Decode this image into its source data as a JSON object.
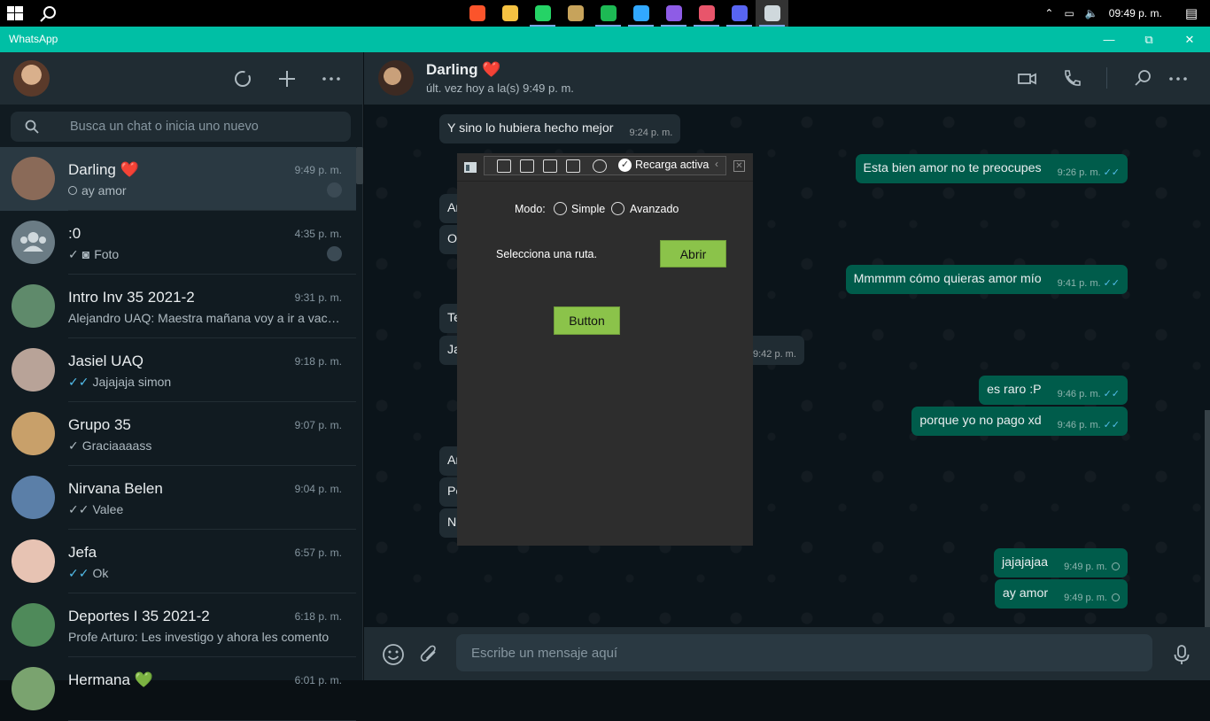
{
  "taskbar": {
    "time": "09:49 p. m.",
    "apps": [
      {
        "name": "brave-icon",
        "color": "#fb542b"
      },
      {
        "name": "file-explorer-icon",
        "color": "#f5c242"
      },
      {
        "name": "whatsapp-icon",
        "color": "#25d366"
      },
      {
        "name": "league-icon",
        "color": "#c7a35b"
      },
      {
        "name": "spotify-icon",
        "color": "#1db954"
      },
      {
        "name": "photoshop-icon",
        "color": "#31a8ff"
      },
      {
        "name": "visual-studio-icon",
        "color": "#8e5ce6"
      },
      {
        "name": "layers-icon",
        "color": "#e8556b"
      },
      {
        "name": "discord-icon",
        "color": "#5865f2"
      },
      {
        "name": "app-window-icon",
        "color": "#cfd8dc"
      }
    ]
  },
  "window": {
    "title": "WhatsApp"
  },
  "sidebar": {
    "search_placeholder": "Busca un chat o inicia uno nuevo",
    "chats": [
      {
        "name": "Darling ❤️",
        "time": "9:49 p. m.",
        "preview": "ay amor",
        "status": "clock",
        "pinned": true,
        "avatar": "#8a6a58"
      },
      {
        "name": ":0",
        "time": "4:35 p. m.",
        "preview": "Foto",
        "status": "single-tick",
        "photo": true,
        "pinned": true,
        "avatar": "#6b7c85"
      },
      {
        "name": "Intro Inv 35 2021-2",
        "time": "9:31 p. m.",
        "preview": "Alejandro UAQ: Maestra mañana voy a ir a vacu...",
        "status": "none",
        "avatar": "#5f8a6b"
      },
      {
        "name": "Jasiel UAQ",
        "time": "9:18 p. m.",
        "preview": "Jajajaja simon",
        "status": "blue-ticks",
        "avatar": "#b8a398"
      },
      {
        "name": "Grupo 35",
        "time": "9:07 p. m.",
        "preview": "Graciaaaass",
        "status": "single-tick",
        "avatar": "#c8a06a"
      },
      {
        "name": "Nirvana Belen",
        "time": "9:04 p. m.",
        "preview": "Valee",
        "status": "grey-ticks",
        "avatar": "#5b7fa8"
      },
      {
        "name": "Jefa",
        "time": "6:57 p. m.",
        "preview": "Ok",
        "status": "blue-ticks",
        "avatar": "#e7c3b3"
      },
      {
        "name": "Deportes I 35 2021-2",
        "time": "6:18 p. m.",
        "preview": "Profe Arturo: Les investigo y ahora les comento",
        "status": "none",
        "avatar": "#4f8a5a"
      },
      {
        "name": "Hermana 💚",
        "time": "6:01 p. m.",
        "preview": "",
        "status": "none",
        "avatar": "#7aa36f"
      }
    ]
  },
  "chat": {
    "contact_name": "Darling ❤️",
    "contact_status": "últ. vez hoy a la(s) 9:49 p. m.",
    "composer_placeholder": "Escribe un mensaje aquí",
    "messages": [
      {
        "dir": "in",
        "text": "Y sino lo hubiera hecho mejor",
        "time": "9:24 p. m."
      },
      {
        "dir": "out",
        "text": "Esta bien amor no te preocupes",
        "time": "9:26 p. m.",
        "status": "read"
      },
      {
        "dir": "in",
        "text": "Ar",
        "time": ""
      },
      {
        "dir": "in",
        "text": "O",
        "time": ""
      },
      {
        "dir": "out",
        "text": "Mmmmm cómo quieras amor mío",
        "time": "9:41 p. m.",
        "status": "read"
      },
      {
        "dir": "in",
        "text": "Te",
        "time": ""
      },
      {
        "dir": "in",
        "text": "Ja",
        "time": "9:42 p. m."
      },
      {
        "dir": "out",
        "text": "es raro :P",
        "time": "9:46 p. m.",
        "status": "read"
      },
      {
        "dir": "out",
        "text": "porque yo no pago xd",
        "time": "9:46 p. m.",
        "status": "read"
      },
      {
        "dir": "in",
        "text": "Ar",
        "time": ""
      },
      {
        "dir": "in",
        "text": "Pe",
        "time": ""
      },
      {
        "dir": "in",
        "text": "N",
        "time": ""
      },
      {
        "dir": "out",
        "text": "jajajajaa",
        "time": "9:49 p. m.",
        "status": "pending"
      },
      {
        "dir": "out",
        "text": "ay amor",
        "time": "9:49 p. m.",
        "status": "pending"
      }
    ]
  },
  "overlay": {
    "reload_label": "Recarga activa",
    "mode_label": "Modo:",
    "mode_options": [
      "Simple",
      "Avanzado"
    ],
    "path_label": "Selecciona una ruta.",
    "open_button": "Abrir",
    "generic_button": "Button"
  }
}
